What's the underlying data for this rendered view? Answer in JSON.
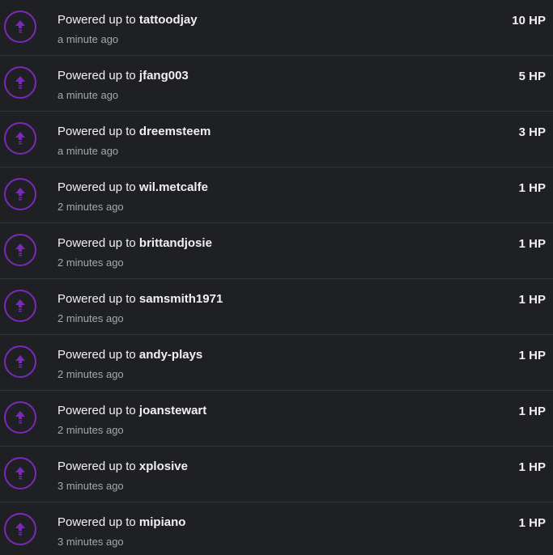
{
  "activity": {
    "icon": "power-up-arrow-icon",
    "accent_color": "#7b2ab8",
    "items": [
      {
        "action": "Powered up to",
        "user": "tattoodjay",
        "time": "a minute ago",
        "amount": "10 HP"
      },
      {
        "action": "Powered up to",
        "user": "jfang003",
        "time": "a minute ago",
        "amount": "5 HP"
      },
      {
        "action": "Powered up to",
        "user": "dreemsteem",
        "time": "a minute ago",
        "amount": "3 HP"
      },
      {
        "action": "Powered up to",
        "user": "wil.metcalfe",
        "time": "2 minutes ago",
        "amount": "1 HP"
      },
      {
        "action": "Powered up to",
        "user": "brittandjosie",
        "time": "2 minutes ago",
        "amount": "1 HP"
      },
      {
        "action": "Powered up to",
        "user": "samsmith1971",
        "time": "2 minutes ago",
        "amount": "1 HP"
      },
      {
        "action": "Powered up to",
        "user": "andy-plays",
        "time": "2 minutes ago",
        "amount": "1 HP"
      },
      {
        "action": "Powered up to",
        "user": "joanstewart",
        "time": "2 minutes ago",
        "amount": "1 HP"
      },
      {
        "action": "Powered up to",
        "user": "xplosive",
        "time": "3 minutes ago",
        "amount": "1 HP"
      },
      {
        "action": "Powered up to",
        "user": "mipiano",
        "time": "3 minutes ago",
        "amount": "1 HP"
      }
    ]
  }
}
